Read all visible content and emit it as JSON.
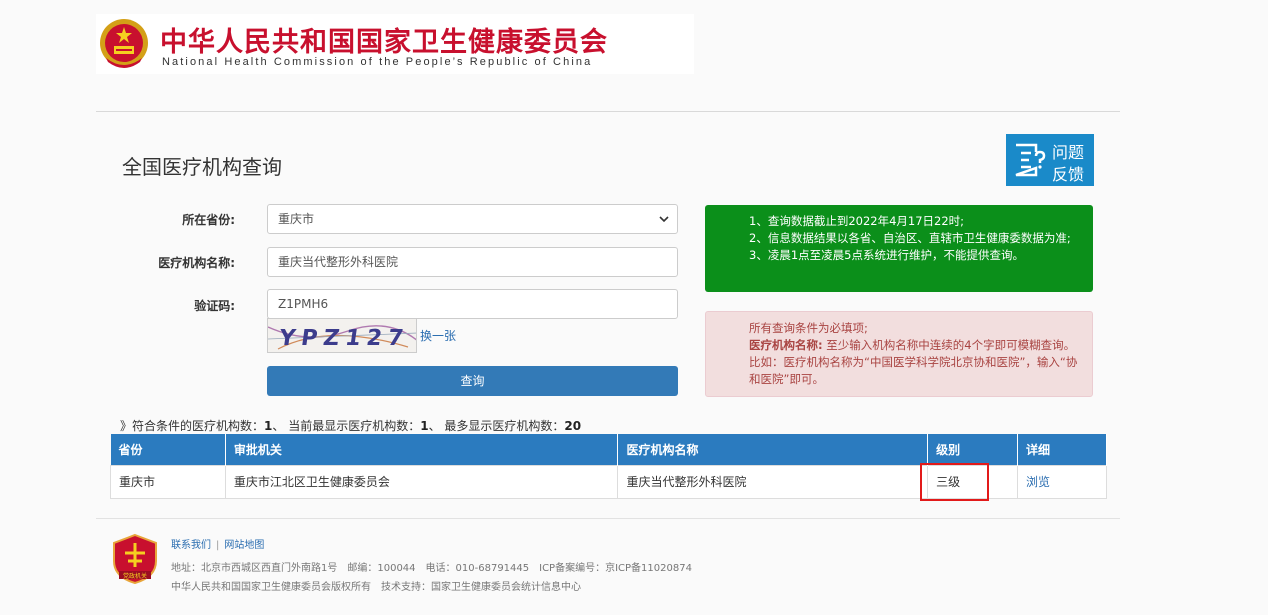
{
  "header": {
    "title_cn": "中华人民共和国国家卫生健康委员会",
    "title_en": "National Health Commission of the People’s Republic of China"
  },
  "page_title": "全国医疗机构查询",
  "feedback": {
    "line1": "问题",
    "line2": "反馈"
  },
  "form": {
    "province_label": "所在省份:",
    "province_value": "重庆市",
    "name_label": "医疗机构名称:",
    "name_value": "重庆当代整形外科医院",
    "captcha_label": "验证码:",
    "captcha_value": "Z1PMH6",
    "captcha_image_text": "YPZ127",
    "refresh_label": "换一张",
    "submit_label": "查询"
  },
  "notice_green": [
    "1、查询数据截止到2022年4月17日22时;",
    "2、信息数据结果以各省、自治区、直辖市卫生健康委数据为准;",
    "3、凌晨1点至凌晨5点系统进行维护，不能提供查询。"
  ],
  "notice_red": {
    "line1": "所有查询条件为必填项;",
    "name_bold": "医疗机构名称:",
    "name_desc": "至少输入机构名称中连续的4个字即可模糊查询。比如：医疗机构名称为“中国医学科学院北京协和医院”，输入“协和医院”即可。"
  },
  "summary": {
    "prefix": "》符合条件的医疗机构数：",
    "matched": "1",
    "current_label": "、 当前最显示医疗机构数：",
    "current": "1",
    "max_label": "、 最多显示医疗机构数：",
    "max": "20"
  },
  "table": {
    "headers": [
      "省份",
      "审批机关",
      "医疗机构名称",
      "级别",
      "详细"
    ],
    "rows": [
      {
        "province": "重庆市",
        "authority": "重庆市江北区卫生健康委员会",
        "name": "重庆当代整形外科医院",
        "level": "三级",
        "detail": "浏览"
      }
    ]
  },
  "footer": {
    "contact": "联系我们",
    "sitemap": "网站地图",
    "address": "地址：北京市西城区西直门外南路1号　邮编：100044　电话：010-68791445　ICP备案编号：京ICP备11020874",
    "copyright": "中华人民共和国国家卫生健康委员会版权所有　技术支持：国家卫生健康委员会统计信息中心",
    "logo_text": "党政机关"
  },
  "colors": {
    "brand_red": "#c8102e",
    "primary_blue": "#337ab7",
    "notice_green": "#0b8f1a",
    "highlight_red": "#e21a1a"
  }
}
